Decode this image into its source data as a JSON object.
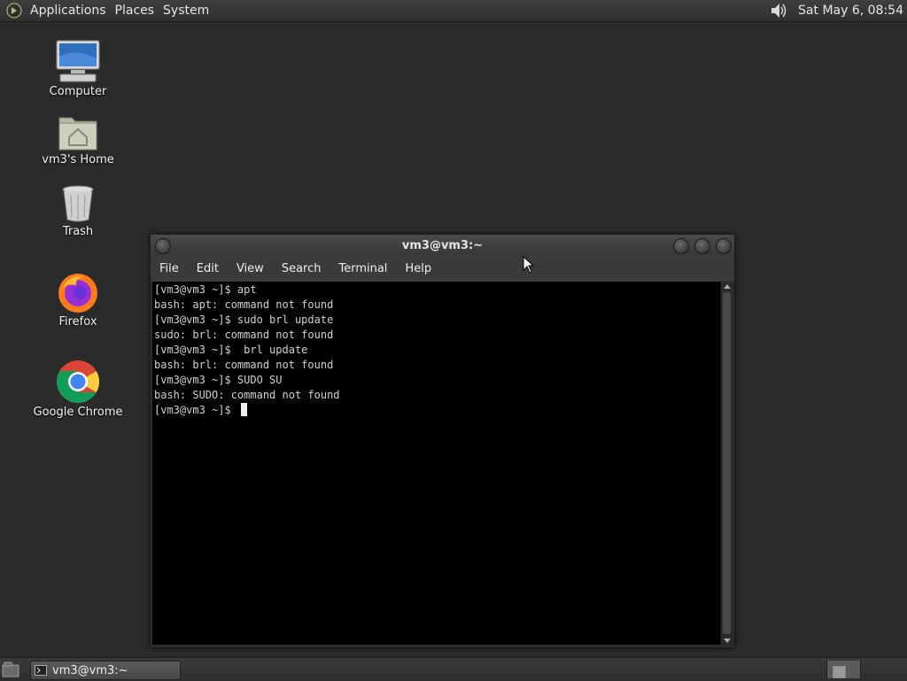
{
  "top_panel": {
    "menus": [
      "Applications",
      "Places",
      "System"
    ],
    "clock": "Sat May  6, 08:54",
    "volume_icon": "speaker-icon"
  },
  "desktop_icons": [
    {
      "label": "Computer",
      "icon": "computer-icon"
    },
    {
      "label": "vm3's Home",
      "icon": "home-folder-icon"
    },
    {
      "label": "Trash",
      "icon": "trash-icon"
    },
    {
      "label": "Firefox",
      "icon": "firefox-icon"
    },
    {
      "label": "Google Chrome",
      "icon": "chrome-icon"
    }
  ],
  "terminal": {
    "title": "vm3@vm3:~",
    "menu": [
      "File",
      "Edit",
      "View",
      "Search",
      "Terminal",
      "Help"
    ],
    "lines": [
      "[vm3@vm3 ~]$ apt",
      "bash: apt: command not found",
      "[vm3@vm3 ~]$ sudo brl update",
      "sudo: brl: command not found",
      "[vm3@vm3 ~]$  brl update",
      "bash: brl: command not found",
      "[vm3@vm3 ~]$ SUDO SU",
      "bash: SUDO: command not found"
    ],
    "prompt": "[vm3@vm3 ~]$ "
  },
  "taskbar": {
    "task_label": "vm3@vm3:~"
  },
  "colors": {
    "desktop_bg": "#2b2b2b",
    "terminal_bg": "#000000",
    "terminal_fg": "#d0d0d0"
  }
}
